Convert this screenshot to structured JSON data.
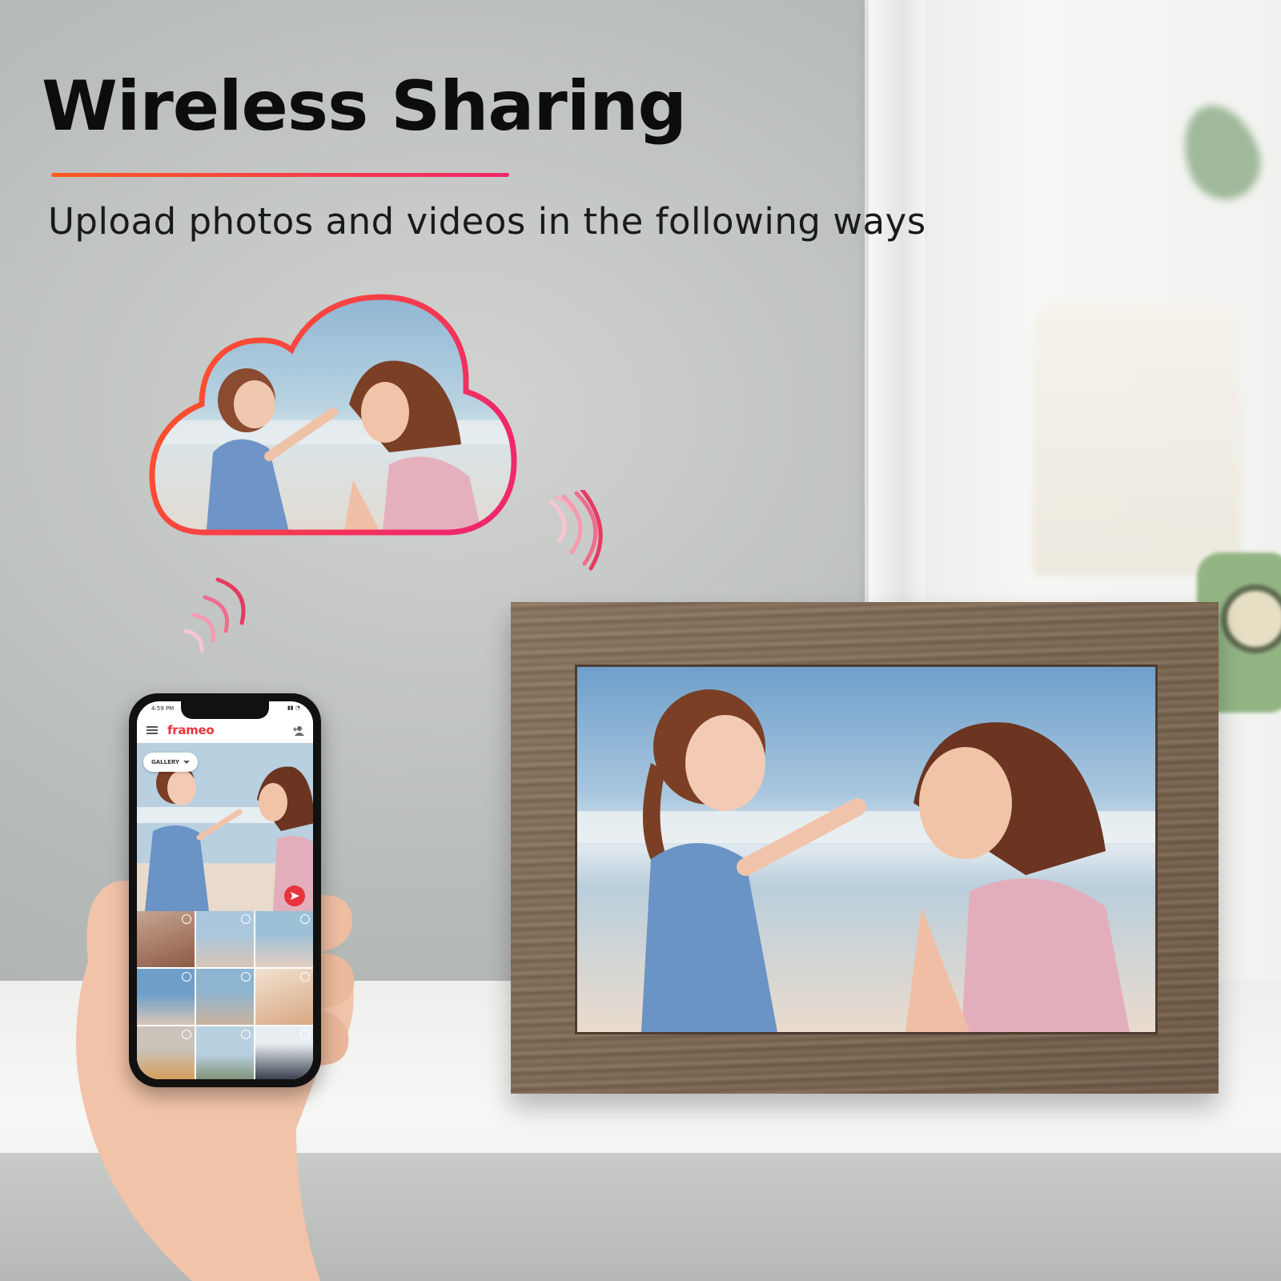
{
  "headline": "Wireless Sharing",
  "subheadline": "Upload photos and videos in the following ways",
  "colors": {
    "accent_start": "#ff5a1f",
    "accent_end": "#f0286a",
    "brand_red": "#e8343d",
    "frame_wood": "#7c6650"
  },
  "phone": {
    "status_time": "4:59 PM",
    "app_name": "frameo",
    "gallery_label": "GALLERY",
    "icons": [
      "menu-icon",
      "add-user-icon",
      "send-icon",
      "chevron-down-icon"
    ]
  }
}
